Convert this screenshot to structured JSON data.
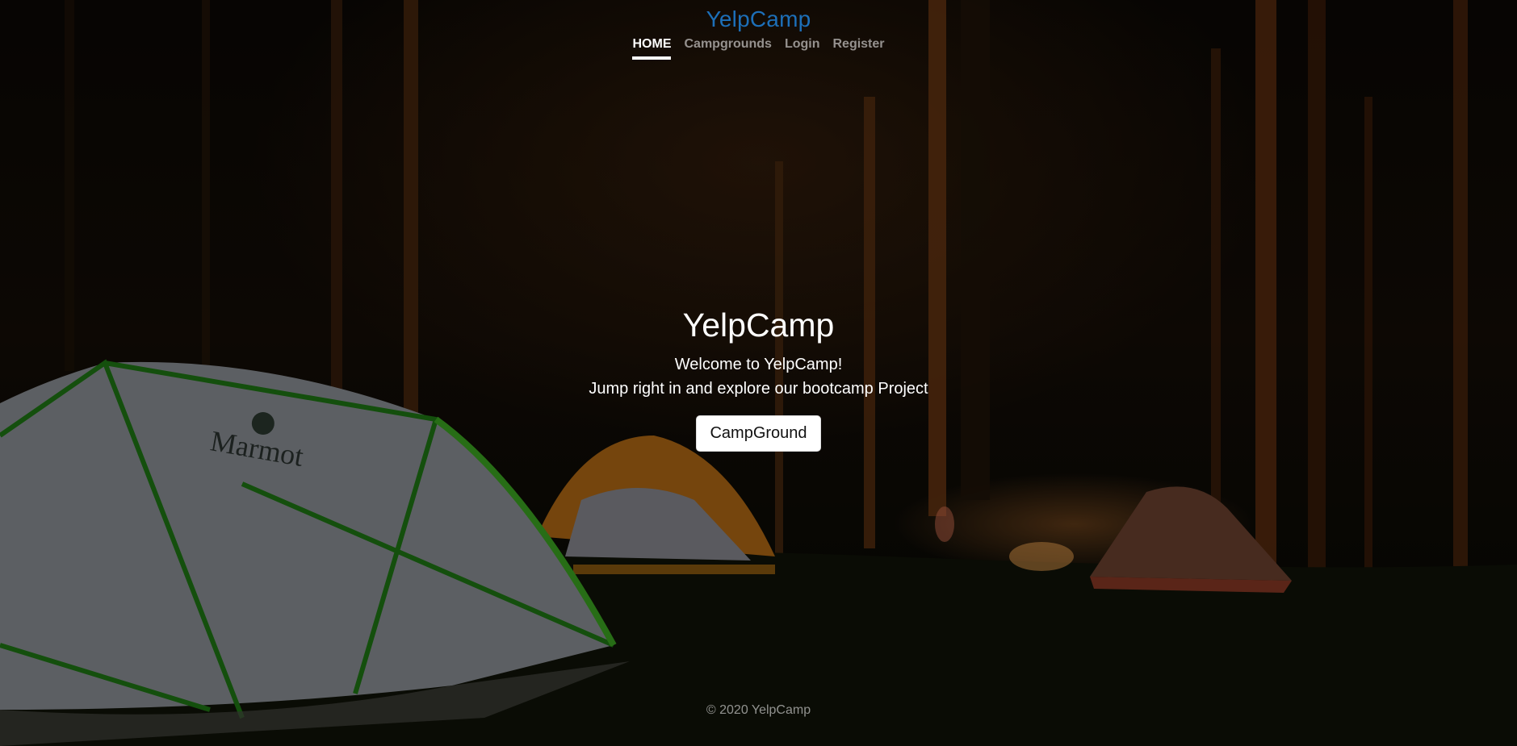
{
  "header": {
    "brand": "YelpCamp",
    "nav": [
      {
        "label": "HOME",
        "active": true
      },
      {
        "label": "Campgrounds",
        "active": false
      },
      {
        "label": "Login",
        "active": false
      },
      {
        "label": "Register",
        "active": false
      }
    ]
  },
  "hero": {
    "title": "YelpCamp",
    "line1": "Welcome to YelpCamp!",
    "line2": "Jump right in and explore our bootcamp Project",
    "button_label": "CampGround"
  },
  "background": {
    "tent_logo_text": "Marmot"
  },
  "footer": {
    "text": "© 2020 YelpCamp"
  },
  "colors": {
    "brand": "#1d6fb8",
    "nav_active": "#ffffff",
    "nav_inactive": "#8c8c8c"
  }
}
